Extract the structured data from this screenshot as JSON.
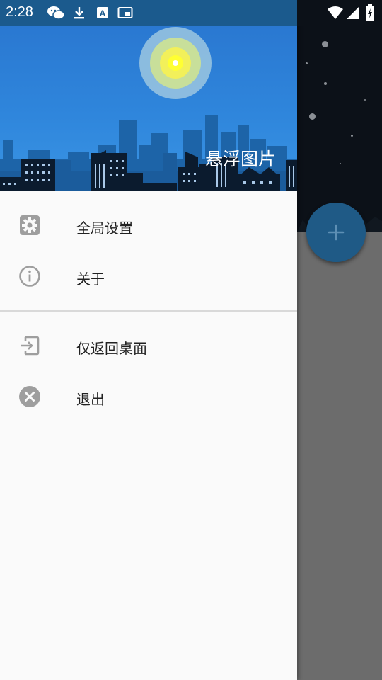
{
  "status_bar": {
    "time": "2:28",
    "icons": [
      "wechat-icon",
      "download-icon",
      "text-a-icon",
      "picture-in-picture-icon",
      "wifi-icon",
      "signal-icon",
      "battery-icon"
    ]
  },
  "drawer": {
    "header_title": "悬浮图片",
    "items": [
      {
        "label": "全局设置",
        "icon": "gear-icon"
      },
      {
        "label": "关于",
        "icon": "info-icon"
      },
      {
        "label": "仅返回桌面",
        "icon": "exit-to-desktop-icon"
      },
      {
        "label": "退出",
        "icon": "close-circle-icon"
      }
    ]
  },
  "fab": {
    "icon": "plus-icon"
  },
  "colors": {
    "drawer_background": "#fafafa",
    "header_sky": "#2f86dc",
    "status_bar": "#1b5a8d",
    "icon_gray": "#9e9e9e",
    "fab": "#1f5a86"
  }
}
